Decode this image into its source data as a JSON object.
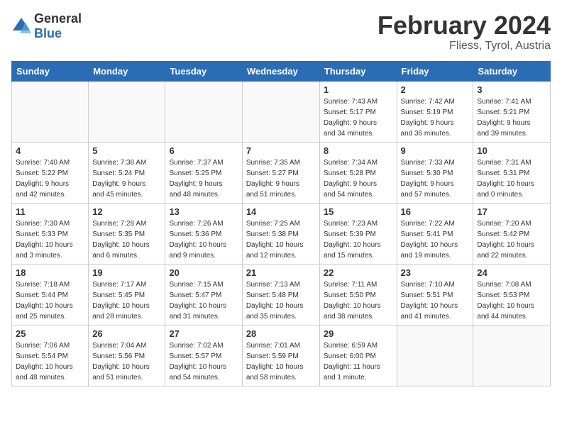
{
  "logo": {
    "text_general": "General",
    "text_blue": "Blue"
  },
  "title": "February 2024",
  "subtitle": "Fliess, Tyrol, Austria",
  "weekdays": [
    "Sunday",
    "Monday",
    "Tuesday",
    "Wednesday",
    "Thursday",
    "Friday",
    "Saturday"
  ],
  "weeks": [
    [
      {
        "day": "",
        "info": ""
      },
      {
        "day": "",
        "info": ""
      },
      {
        "day": "",
        "info": ""
      },
      {
        "day": "",
        "info": ""
      },
      {
        "day": "1",
        "info": "Sunrise: 7:43 AM\nSunset: 5:17 PM\nDaylight: 9 hours\nand 34 minutes."
      },
      {
        "day": "2",
        "info": "Sunrise: 7:42 AM\nSunset: 5:19 PM\nDaylight: 9 hours\nand 36 minutes."
      },
      {
        "day": "3",
        "info": "Sunrise: 7:41 AM\nSunset: 5:21 PM\nDaylight: 9 hours\nand 39 minutes."
      }
    ],
    [
      {
        "day": "4",
        "info": "Sunrise: 7:40 AM\nSunset: 5:22 PM\nDaylight: 9 hours\nand 42 minutes."
      },
      {
        "day": "5",
        "info": "Sunrise: 7:38 AM\nSunset: 5:24 PM\nDaylight: 9 hours\nand 45 minutes."
      },
      {
        "day": "6",
        "info": "Sunrise: 7:37 AM\nSunset: 5:25 PM\nDaylight: 9 hours\nand 48 minutes."
      },
      {
        "day": "7",
        "info": "Sunrise: 7:35 AM\nSunset: 5:27 PM\nDaylight: 9 hours\nand 51 minutes."
      },
      {
        "day": "8",
        "info": "Sunrise: 7:34 AM\nSunset: 5:28 PM\nDaylight: 9 hours\nand 54 minutes."
      },
      {
        "day": "9",
        "info": "Sunrise: 7:33 AM\nSunset: 5:30 PM\nDaylight: 9 hours\nand 57 minutes."
      },
      {
        "day": "10",
        "info": "Sunrise: 7:31 AM\nSunset: 5:31 PM\nDaylight: 10 hours\nand 0 minutes."
      }
    ],
    [
      {
        "day": "11",
        "info": "Sunrise: 7:30 AM\nSunset: 5:33 PM\nDaylight: 10 hours\nand 3 minutes."
      },
      {
        "day": "12",
        "info": "Sunrise: 7:28 AM\nSunset: 5:35 PM\nDaylight: 10 hours\nand 6 minutes."
      },
      {
        "day": "13",
        "info": "Sunrise: 7:26 AM\nSunset: 5:36 PM\nDaylight: 10 hours\nand 9 minutes."
      },
      {
        "day": "14",
        "info": "Sunrise: 7:25 AM\nSunset: 5:38 PM\nDaylight: 10 hours\nand 12 minutes."
      },
      {
        "day": "15",
        "info": "Sunrise: 7:23 AM\nSunset: 5:39 PM\nDaylight: 10 hours\nand 15 minutes."
      },
      {
        "day": "16",
        "info": "Sunrise: 7:22 AM\nSunset: 5:41 PM\nDaylight: 10 hours\nand 19 minutes."
      },
      {
        "day": "17",
        "info": "Sunrise: 7:20 AM\nSunset: 5:42 PM\nDaylight: 10 hours\nand 22 minutes."
      }
    ],
    [
      {
        "day": "18",
        "info": "Sunrise: 7:18 AM\nSunset: 5:44 PM\nDaylight: 10 hours\nand 25 minutes."
      },
      {
        "day": "19",
        "info": "Sunrise: 7:17 AM\nSunset: 5:45 PM\nDaylight: 10 hours\nand 28 minutes."
      },
      {
        "day": "20",
        "info": "Sunrise: 7:15 AM\nSunset: 5:47 PM\nDaylight: 10 hours\nand 31 minutes."
      },
      {
        "day": "21",
        "info": "Sunrise: 7:13 AM\nSunset: 5:48 PM\nDaylight: 10 hours\nand 35 minutes."
      },
      {
        "day": "22",
        "info": "Sunrise: 7:11 AM\nSunset: 5:50 PM\nDaylight: 10 hours\nand 38 minutes."
      },
      {
        "day": "23",
        "info": "Sunrise: 7:10 AM\nSunset: 5:51 PM\nDaylight: 10 hours\nand 41 minutes."
      },
      {
        "day": "24",
        "info": "Sunrise: 7:08 AM\nSunset: 5:53 PM\nDaylight: 10 hours\nand 44 minutes."
      }
    ],
    [
      {
        "day": "25",
        "info": "Sunrise: 7:06 AM\nSunset: 5:54 PM\nDaylight: 10 hours\nand 48 minutes."
      },
      {
        "day": "26",
        "info": "Sunrise: 7:04 AM\nSunset: 5:56 PM\nDaylight: 10 hours\nand 51 minutes."
      },
      {
        "day": "27",
        "info": "Sunrise: 7:02 AM\nSunset: 5:57 PM\nDaylight: 10 hours\nand 54 minutes."
      },
      {
        "day": "28",
        "info": "Sunrise: 7:01 AM\nSunset: 5:59 PM\nDaylight: 10 hours\nand 58 minutes."
      },
      {
        "day": "29",
        "info": "Sunrise: 6:59 AM\nSunset: 6:00 PM\nDaylight: 11 hours\nand 1 minute."
      },
      {
        "day": "",
        "info": ""
      },
      {
        "day": "",
        "info": ""
      }
    ]
  ]
}
